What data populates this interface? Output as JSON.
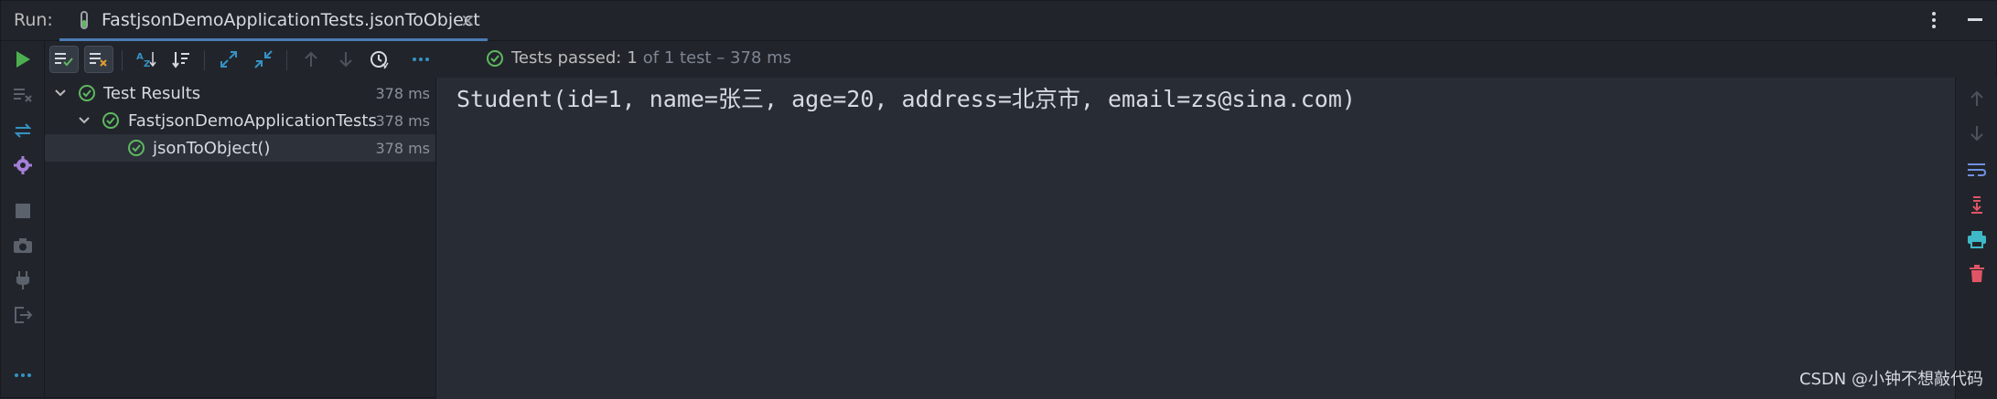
{
  "window": {
    "run_label": "Run:",
    "tab_title": "FastjsonDemoApplicationTests.jsonToObject",
    "tab_close": "×"
  },
  "toolbar": {
    "status_passed": "Tests passed:",
    "status_count": "1",
    "status_rest": "of 1 test – 378 ms"
  },
  "tree": {
    "items": [
      {
        "label": "Test Results",
        "time": "378 ms"
      },
      {
        "label": "FastjsonDemoApplicationTests",
        "time": "378 ms"
      },
      {
        "label": "jsonToObject()",
        "time": "378 ms"
      }
    ]
  },
  "console": {
    "output": "Student(id=1, name=张三, age=20, address=北京市, email=zs@sina.com)"
  },
  "watermark": "CSDN @小钟不想敲代码",
  "colors": {
    "pass_green": "#5fb760",
    "accent_blue": "#4b7bb5",
    "run_green": "#4caf50"
  }
}
